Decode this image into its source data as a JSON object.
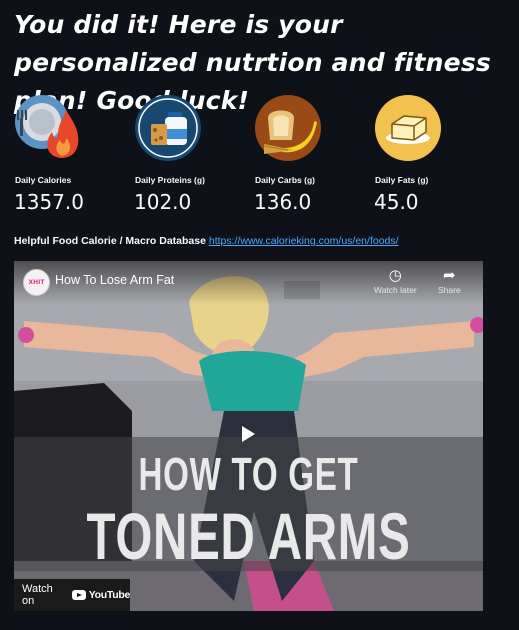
{
  "title": "You did it! Here is your personalized nutrtion and fitness plan! Good luck!",
  "metrics": [
    {
      "label": "Daily Calories",
      "value": "1357.0",
      "icon": "calories-plate-flame-icon"
    },
    {
      "label": "Daily Proteins (g)",
      "value": "102.0",
      "icon": "protein-milk-icon"
    },
    {
      "label": "Daily Carbs (g)",
      "value": "136.0",
      "icon": "carbs-bread-banana-icon"
    },
    {
      "label": "Daily Fats (g)",
      "value": "45.0",
      "icon": "fats-butter-icon"
    }
  ],
  "database": {
    "label": "Helpful Food Calorie / Macro Database",
    "url_text": "https://www.calorieking.com/us/en/foods/"
  },
  "video": {
    "channel_logo_text": "XHIT",
    "title": "How To Lose Arm Fat",
    "watch_later": "Watch later",
    "share": "Share",
    "overlay_line1": "HOW TO GET",
    "overlay_line2": "TONED ARMS",
    "watch_on": "Watch on",
    "youtube": "YouTube"
  },
  "colors": {
    "background": "#0e1117",
    "link": "#4ea8ff",
    "calories_icon_bg": "#5b93c4",
    "protein_icon_bg": "#174870",
    "carbs_icon_bg": "#9a4a16",
    "fats_icon_bg": "#f2c14e"
  }
}
